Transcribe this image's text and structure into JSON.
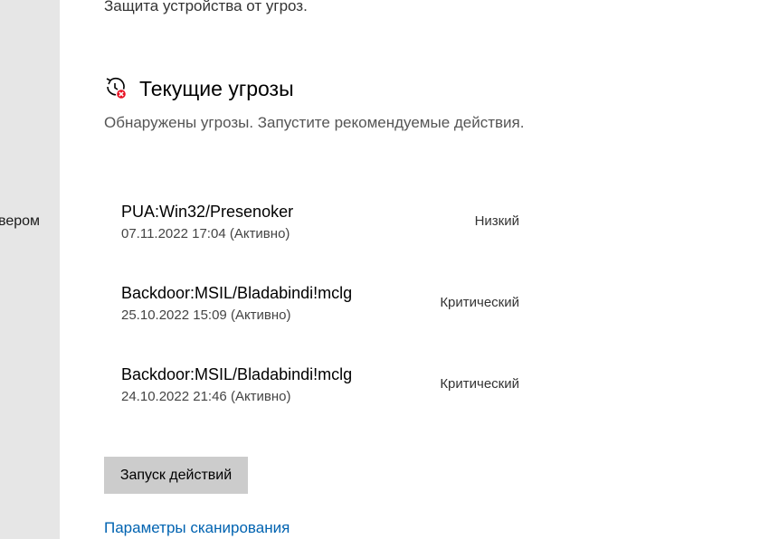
{
  "sidebar": {
    "fragment_text": "вером"
  },
  "protection": {
    "subtitle": "Защита устройства от угроз."
  },
  "current_threats": {
    "icon": "threat-history-icon",
    "title": "Текущие угрозы",
    "description": "Обнаружены угрозы. Запустите рекомендуемые действия.",
    "items": [
      {
        "name": "PUA:Win32/Presenoker",
        "date": "07.11.2022 17:04 (Активно)",
        "severity": "Низкий"
      },
      {
        "name": "Backdoor:MSIL/Bladabindi!mclg",
        "date": "25.10.2022 15:09 (Активно)",
        "severity": "Критический"
      },
      {
        "name": "Backdoor:MSIL/Bladabindi!mclg",
        "date": "24.10.2022 21:46 (Активно)",
        "severity": "Критический"
      }
    ],
    "action_button_label": "Запуск действий",
    "scan_options_link": "Параметры сканирования"
  },
  "colors": {
    "sidebar_bg": "#e6e6e6",
    "button_bg": "#cccccc",
    "link": "#0063b1",
    "threat_badge": "#e81123"
  }
}
